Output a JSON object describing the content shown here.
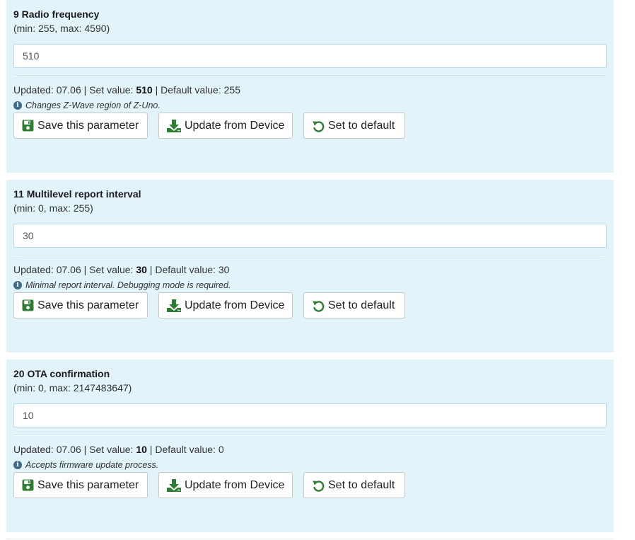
{
  "buttons": {
    "save": "Save this parameter",
    "update": "Update from Device",
    "default": "Set to default"
  },
  "labels": {
    "updated_prefix": "Updated: ",
    "set_value_prefix": " | Set value: ",
    "default_value_prefix": " | Default value: "
  },
  "parameters": [
    {
      "title": "9 Radio frequency",
      "range": "(min: 255, max: 4590)",
      "input_value": "510",
      "updated": "07.06",
      "set_value": "510",
      "default_value": "255",
      "hint": "Changes Z-Wave region of Z-Uno."
    },
    {
      "title": "11 Multilevel report interval",
      "range": "(min: 0, max: 255)",
      "input_value": "30",
      "updated": "07.06",
      "set_value": "30",
      "default_value": "30",
      "hint": "Minimal report interval. Debugging mode is required."
    },
    {
      "title": "20 OTA confirmation",
      "range": "(min: 0, max: 2147483647)",
      "input_value": "10",
      "updated": "07.06",
      "set_value": "10",
      "default_value": "0",
      "hint": "Accepts firmware update process."
    }
  ],
  "colors": {
    "panel_background": "#e2f3fa",
    "icon_green": "#2e7d32",
    "info_icon": "#3f6b8a"
  },
  "icons": {
    "save": "floppy-disk-icon",
    "update": "download-icon",
    "default": "undo-icon",
    "hint": "info-circle-icon"
  }
}
